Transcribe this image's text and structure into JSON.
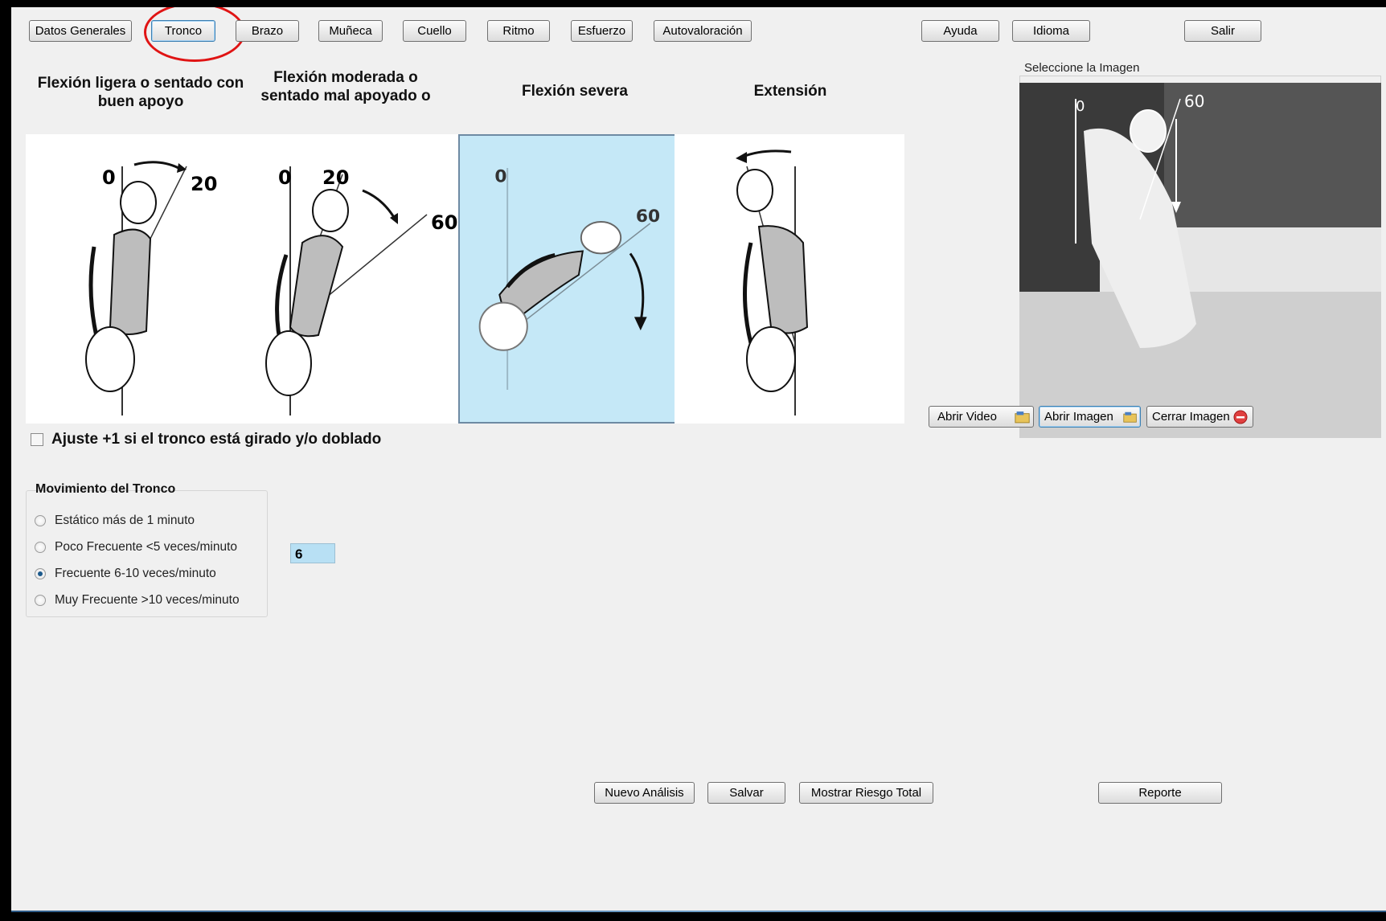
{
  "nav": {
    "datos_generales": "Datos Generales",
    "tronco": "Tronco",
    "brazo": "Brazo",
    "muneca": "Muñeca",
    "cuello": "Cuello",
    "ritmo": "Ritmo",
    "esfuerzo": "Esfuerzo",
    "autovaloracion": "Autovaloración",
    "ayuda": "Ayuda",
    "idioma": "Idioma",
    "salir": "Salir"
  },
  "postures": [
    {
      "title": "Flexión ligera o sentado con buen apoyo",
      "angle_a": "0",
      "angle_b": "20"
    },
    {
      "title": "Flexión moderada o sentado mal apoyado o",
      "angle_a": "0",
      "angle_b": "20",
      "angle_c": "60"
    },
    {
      "title": "Flexión severa",
      "angle_a": "0",
      "angle_b": "60"
    },
    {
      "title": "Extensión"
    }
  ],
  "selected_posture": "Flexión severa",
  "adjust_checkbox": {
    "label": "Ajuste +1 si el tronco está girado y/o doblado",
    "checked": false
  },
  "movement": {
    "title": "Movimiento del Tronco",
    "options": [
      "Estático más de 1 minuto",
      "Poco Frecuente <5 veces/minuto",
      "Frecuente 6-10 veces/minuto",
      "Muy Frecuente >10 veces/minuto"
    ],
    "selected": "Frecuente 6-10 veces/minuto"
  },
  "score": "6",
  "image_panel": {
    "label": "Seleccione la Imagen",
    "overlay_angle": "60",
    "overlay_zero": "0",
    "open_video": "Abrir Video",
    "open_image": "Abrir Imagen",
    "close_image": "Cerrar Imagen"
  },
  "footer": {
    "nuevo": "Nuevo Análisis",
    "salvar": "Salvar",
    "mostrar": "Mostrar Riesgo Total",
    "reporte": "Reporte"
  },
  "colors": {
    "highlight_ring": "#e01414",
    "selected_panel": "#c5e8f7",
    "score_bg": "#b8e0f4"
  }
}
